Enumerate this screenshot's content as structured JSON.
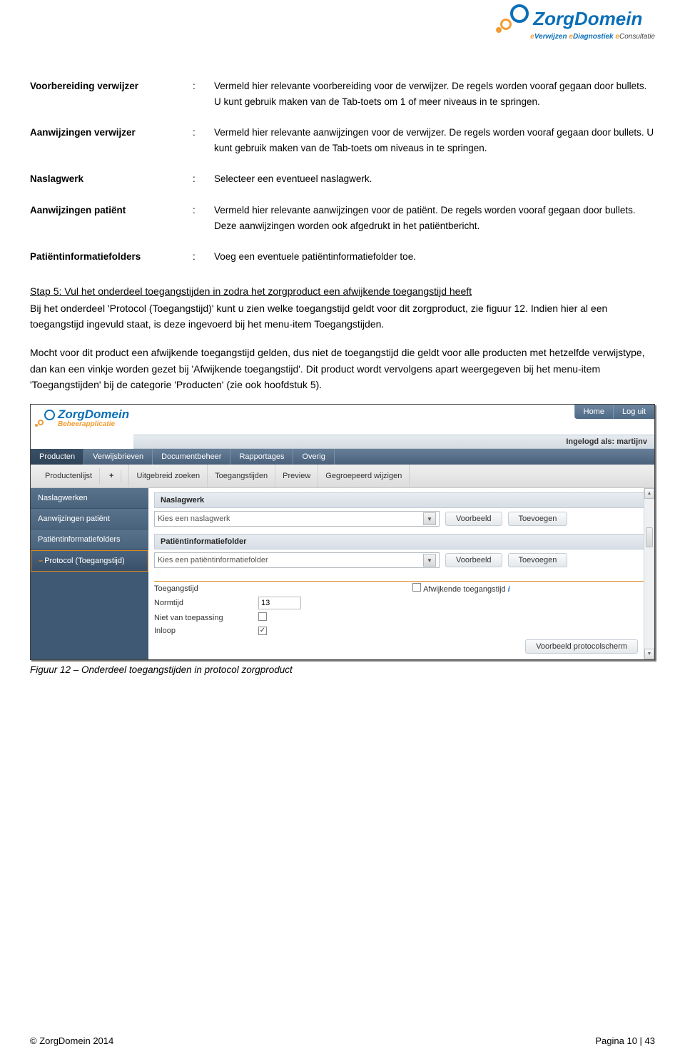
{
  "logo": {
    "brand": "ZorgDomein",
    "tagline_parts": [
      "e",
      "Verwijzen ",
      "e",
      "Diagnostiek ",
      "e",
      "Consultatie"
    ]
  },
  "definitions": [
    {
      "label": "Voorbereiding verwijzer",
      "value": "Vermeld hier relevante voorbereiding voor de verwijzer. De regels worden vooraf gegaan door bullets. U kunt gebruik maken van de Tab-toets om 1 of meer niveaus in te springen."
    },
    {
      "label": "Aanwijzingen verwijzer",
      "value": "Vermeld hier relevante aanwijzingen voor de verwijzer. De regels worden vooraf gegaan door bullets. U kunt gebruik maken van de Tab-toets om niveaus in te springen."
    },
    {
      "label": "Naslagwerk",
      "value": "Selecteer een eventueel naslagwerk."
    },
    {
      "label": "Aanwijzingen patiënt",
      "value": "Vermeld hier relevante aanwijzingen voor de patiënt. De regels worden vooraf gegaan door bullets. Deze aanwijzingen worden ook afgedrukt in het patiëntbericht."
    },
    {
      "label": "Patiëntinformatiefolders",
      "value": "Voeg een eventuele patiëntinformatiefolder toe."
    }
  ],
  "body": {
    "step5_heading": "Stap 5: Vul het onderdeel toegangstijden in zodra het zorgproduct een afwijkende toegangstijd heeft",
    "para1": "Bij het onderdeel 'Protocol (Toegangstijd)' kunt u zien welke toegangstijd geldt voor dit zorgproduct, zie figuur 12. Indien hier al een toegangstijd ingevuld staat, is deze ingevoerd bij het menu-item Toegangstijden.",
    "para2": "Mocht voor dit product een afwijkende toegangstijd gelden, dus niet de toegangstijd die geldt voor alle producten met hetzelfde verwijstype, dan kan een vinkje worden gezet bij 'Afwijkende toegangstijd'. Dit product wordt vervolgens apart weergegeven bij het menu-item 'Toegangstijden' bij de categorie 'Producten' (zie ook hoofdstuk 5)."
  },
  "app": {
    "brand": "ZorgDomein",
    "brand_sub": "Beheerapplicatie",
    "top_nav": [
      "Home",
      "Log uit"
    ],
    "login_label": "Ingelogd als: martijnv",
    "main_tabs": [
      "Producten",
      "Verwijsbrieven",
      "Documentbeheer",
      "Rapportages",
      "Overig"
    ],
    "sub_tabs": [
      "Productenlijst",
      "Uitgebreid zoeken",
      "Toegangstijden",
      "Preview",
      "Gegroepeerd wijzigen"
    ],
    "sidebar": [
      "Naslagwerken",
      "Aanwijzingen patiënt",
      "Patiëntinformatiefolders",
      "Protocol (Toegangstijd)"
    ],
    "panel1": {
      "title": "Naslagwerk",
      "select": "Kies een naslagwerk",
      "btn1": "Voorbeeld",
      "btn2": "Toevoegen"
    },
    "panel2": {
      "title": "Patiëntinformatiefolder",
      "select": "Kies een patiëntinformatiefolder",
      "btn1": "Voorbeeld",
      "btn2": "Toevoegen"
    },
    "protocol": {
      "rows": {
        "toegangstijd": "Toegangstijd",
        "normtijd": {
          "label": "Normtijd",
          "value": "13"
        },
        "nvt": "Niet van toepassing",
        "inloop": "Inloop",
        "afwijkend": "Afwijkende toegangstijd"
      },
      "preview_btn": "Voorbeeld protocolscherm"
    }
  },
  "caption": "Figuur 12 – Onderdeel toegangstijden in protocol zorgproduct",
  "footer": {
    "left": "© ZorgDomein 2014",
    "right": "Pagina 10 | 43"
  }
}
